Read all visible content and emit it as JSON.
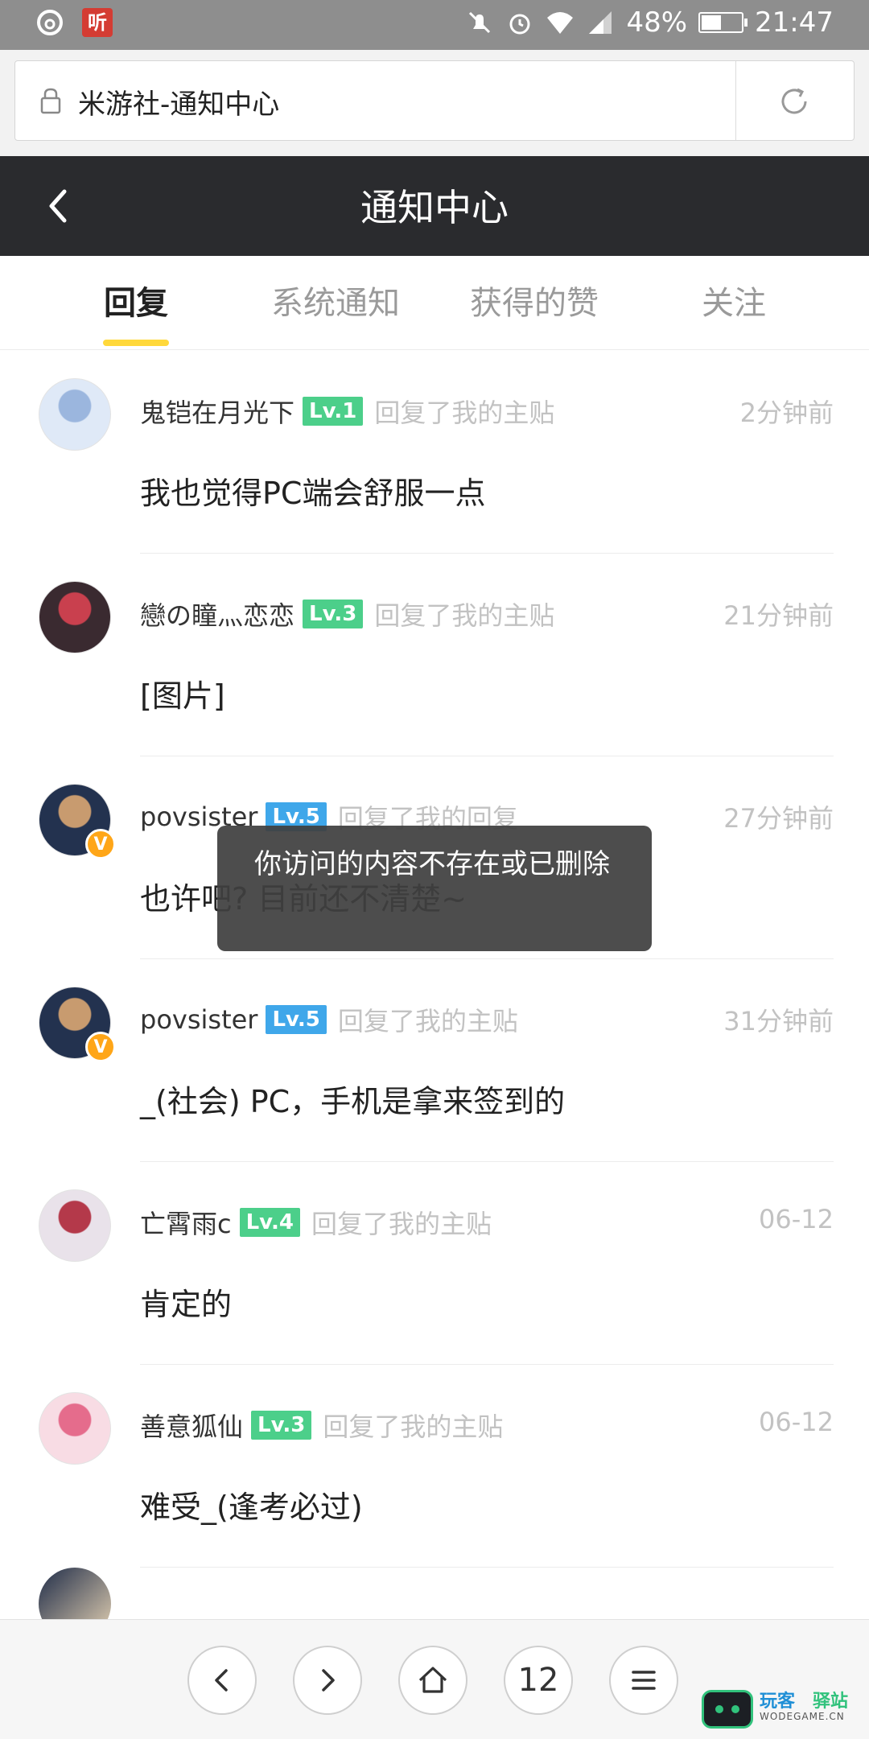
{
  "status_bar": {
    "battery": "48%",
    "time": "21:47",
    "ting_label": "听"
  },
  "browser": {
    "page_title": "米游社-通知中心"
  },
  "header": {
    "title": "通知中心"
  },
  "tabs": [
    {
      "label": "回复",
      "active": true
    },
    {
      "label": "系统通知",
      "active": false
    },
    {
      "label": "获得的赞",
      "active": false
    },
    {
      "label": "关注",
      "active": false
    }
  ],
  "notifications": [
    {
      "user": "鬼铠在月光下",
      "level": "Lv.1",
      "level_color": "#4ccf8a",
      "action": "回复了我的主贴",
      "time": "2分钟前",
      "content": "我也觉得PC端会舒服一点",
      "verified": false,
      "avatar_colors": [
        "#dfe9f7",
        "#9bb6de"
      ]
    },
    {
      "user": "戀の瞳灬恋恋",
      "level": "Lv.3",
      "level_color": "#4ccf8a",
      "action": "回复了我的主贴",
      "time": "21分钟前",
      "content": "[图片]",
      "verified": false,
      "avatar_colors": [
        "#3a2a30",
        "#c9404e"
      ]
    },
    {
      "user": "povsister",
      "level": "Lv.5",
      "level_color": "#3fa7ea",
      "action": "回复了我的回复",
      "time": "27分钟前",
      "content": "也许吧? 目前还不清楚~",
      "verified": true,
      "verified_label": "V",
      "avatar_colors": [
        "#23324f",
        "#c89b6f"
      ]
    },
    {
      "user": "povsister",
      "level": "Lv.5",
      "level_color": "#3fa7ea",
      "action": "回复了我的主贴",
      "time": "31分钟前",
      "content": "_(社会) PC，手机是拿来签到的",
      "verified": true,
      "verified_label": "V",
      "avatar_colors": [
        "#23324f",
        "#c89b6f"
      ]
    },
    {
      "user": "亡霄雨c",
      "level": "Lv.4",
      "level_color": "#4ccf8a",
      "action": "回复了我的主贴",
      "time": "06-12",
      "content": "肯定的",
      "verified": false,
      "avatar_colors": [
        "#e9e2ea",
        "#b4394a"
      ]
    },
    {
      "user": "善意狐仙",
      "level": "Lv.3",
      "level_color": "#4ccf8a",
      "action": "回复了我的主贴",
      "time": "06-12",
      "content": "难受_(逢考必过)",
      "verified": false,
      "avatar_colors": [
        "#f8dce4",
        "#e56c8c"
      ]
    }
  ],
  "toast": {
    "message": "你访问的内容不存在或已删除"
  },
  "bottom_nav": {
    "tab_count": "12"
  },
  "watermark": {
    "line1a": "玩客",
    "line1b": "驿站",
    "line2": "WODEGAME.CN"
  }
}
